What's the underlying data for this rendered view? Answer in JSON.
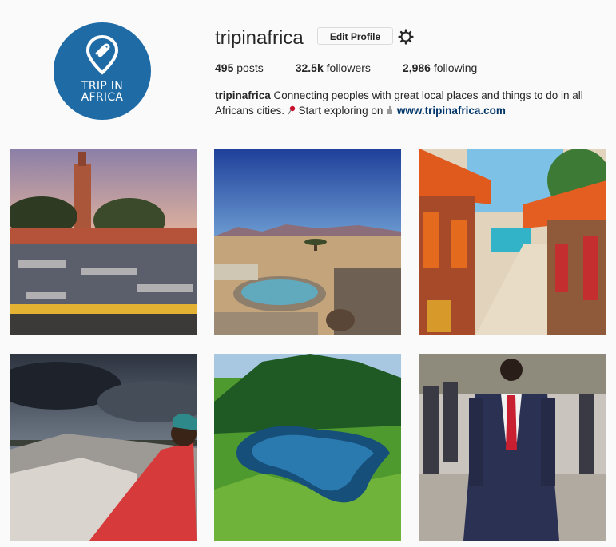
{
  "profile": {
    "username": "tripinafrica",
    "edit_profile_label": "Edit Profile",
    "avatar_text_line1": "TRIP IN",
    "avatar_text_line2": "AFRICA",
    "stats": {
      "posts_count": "495",
      "posts_label": "posts",
      "followers_count": "32.5k",
      "followers_label": "followers",
      "following_count": "2,986",
      "following_label": "following"
    },
    "bio": {
      "name": "tripinafrica",
      "text_part1": " Connecting peoples with great local places and things to do in all Africans cities. ",
      "text_part2": " Start exploring on ",
      "link": "www.tripinafrica.com"
    }
  },
  "icons": {
    "settings": "gear-icon",
    "pin": "map-pin-icon",
    "pointer": "pointing-hand-icon"
  },
  "colors": {
    "avatar_bg": "#1e6ba6",
    "link": "#003569",
    "page_bg": "#fafafa"
  },
  "posts": [
    {
      "subject": "marrakech-square"
    },
    {
      "subject": "desert-pool"
    },
    {
      "subject": "beach-market"
    },
    {
      "subject": "woman-in-boat"
    },
    {
      "subject": "crater-lake"
    },
    {
      "subject": "man-in-suit"
    }
  ]
}
